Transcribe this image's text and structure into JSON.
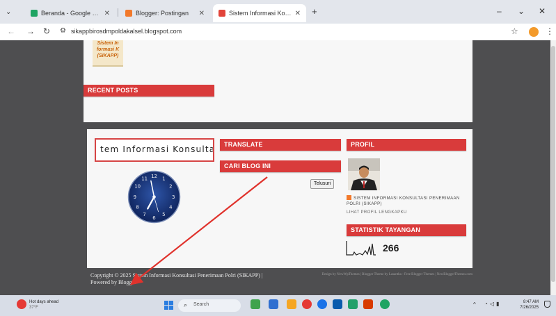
{
  "browser": {
    "tabs": [
      {
        "label": "Beranda - Google Drive",
        "active": false,
        "favicon_color": "#1fa463"
      },
      {
        "label": "Blogger: Postingan",
        "active": false,
        "favicon_color": "#f2792b"
      },
      {
        "label": "Sistem Informasi Konsultasi Pe",
        "active": true,
        "favicon_color": "#e2443a"
      }
    ],
    "new_tab": "+",
    "url": "sikappbirosdmpoldakalsel.blogspot.com",
    "window_controls": {
      "minimize": "–",
      "restore": "⌄",
      "close": "✕"
    }
  },
  "page": {
    "logo_lines": [
      "Sistem In",
      "formasi K",
      "(SIKAPP)"
    ],
    "recent_posts_title": "RECENT POSTS",
    "marquee_text": "tem Informasi Konsulta",
    "translate_title": "TRANSLATE",
    "search_blog_title": "CARI BLOG INI",
    "search_button": "Telusuri",
    "profile_title": "PROFIL",
    "profile_name": "SISTEM INFORMASI KONSULTASI PENERIMAAN POLRI (SIKAPP)",
    "profile_link": "LIHAT PROFIL LENGKAPKU",
    "stats_title": "STATISTIK TAYANGAN",
    "stats_count": "266",
    "footer_copyright": "Copyright © 2025 Sistem Informasi Konsultasi Penerimaan Polri (SIKAPP) |",
    "footer_powered": "Powered by Blogger",
    "footer_design": "Design by NewWpThemes | Blogger Theme by Lasantha - Free Blogger Themes | NewBloggerThemes.com"
  },
  "taskbar": {
    "weather_title": "Hot days ahead",
    "weather_temp": "37°F",
    "search_placeholder": "Search",
    "time": "8:47 AM",
    "date": "7/26/2025",
    "app_colors": [
      "#3fa34d",
      "#2f6fd0",
      "#f5a623",
      "#e53935",
      "#1a73e8",
      "#0b5cad",
      "#22a06b",
      "#d83b01",
      "#1fa463"
    ]
  }
}
